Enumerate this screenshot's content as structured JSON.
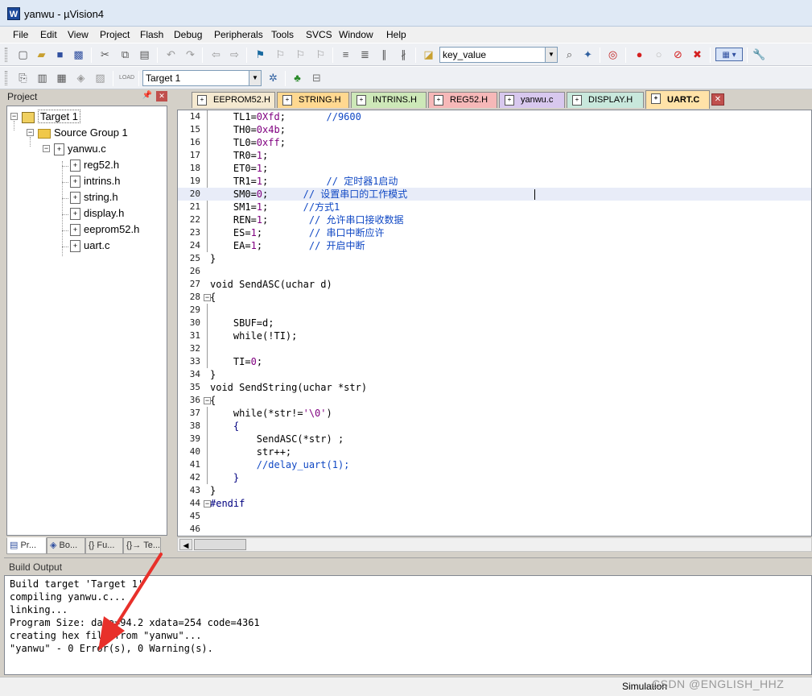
{
  "window": {
    "title": "yanwu  - µVision4",
    "icon": "uvision-app-icon"
  },
  "menu": [
    "File",
    "Edit",
    "View",
    "Project",
    "Flash",
    "Debug",
    "Peripherals",
    "Tools",
    "SVCS",
    "Window",
    "Help"
  ],
  "toolbar": {
    "find_combo_value": "key_value",
    "target_combo_value": "Target 1"
  },
  "project": {
    "title": "Project",
    "target": "Target 1",
    "group": "Source Group 1",
    "main_file": "yanwu.c",
    "files": [
      "reg52.h",
      "intrins.h",
      "string.h",
      "display.h",
      "eeprom52.h",
      "uart.c"
    ],
    "tabs": [
      "Pr...",
      "Bo...",
      "{} Fu...",
      "{}→ Te..."
    ]
  },
  "editor": {
    "tabs": [
      {
        "label": "EEPROM52.H",
        "color": "#f5e9d0"
      },
      {
        "label": "STRING.H",
        "color": "#ffd890"
      },
      {
        "label": "INTRINS.H",
        "color": "#cde8b8"
      },
      {
        "label": "REG52.H",
        "color": "#f6b8b8"
      },
      {
        "label": "yanwu.c",
        "color": "#d8c8ee"
      },
      {
        "label": "DISPLAY.H",
        "color": "#c8e8dc"
      },
      {
        "label": "UART.C",
        "color": "#ffe2a8"
      }
    ],
    "lines": [
      {
        "n": "14",
        "code": "    TL1=0Xfd;       //9600"
      },
      {
        "n": "15",
        "code": "    TH0=0x4b;"
      },
      {
        "n": "16",
        "code": "    TL0=0xff;"
      },
      {
        "n": "17",
        "code": "    TR0=1;"
      },
      {
        "n": "18",
        "code": "    ET0=1;"
      },
      {
        "n": "19",
        "code": "    TR1=1;          // 定时器1启动"
      },
      {
        "n": "20",
        "code": "    SM0=0;      // 设置串口的工作模式"
      },
      {
        "n": "21",
        "code": "    SM1=1;      //方式1"
      },
      {
        "n": "22",
        "code": "    REN=1;       // 允许串口接收数据"
      },
      {
        "n": "23",
        "code": "    ES=1;        // 串口中断应许"
      },
      {
        "n": "24",
        "code": "    EA=1;        // 开启中断"
      },
      {
        "n": "25",
        "code": "}"
      },
      {
        "n": "26",
        "code": ""
      },
      {
        "n": "27",
        "code": "void SendASC(uchar d)"
      },
      {
        "n": "28",
        "code": "{"
      },
      {
        "n": "29",
        "code": ""
      },
      {
        "n": "30",
        "code": "    SBUF=d;"
      },
      {
        "n": "31",
        "code": "    while(!TI);"
      },
      {
        "n": "32",
        "code": ""
      },
      {
        "n": "33",
        "code": "    TI=0;"
      },
      {
        "n": "34",
        "code": "}"
      },
      {
        "n": "35",
        "code": "void SendString(uchar *str)"
      },
      {
        "n": "36",
        "code": "{"
      },
      {
        "n": "37",
        "code": "    while(*str!='\\0')"
      },
      {
        "n": "38",
        "code": "    {"
      },
      {
        "n": "39",
        "code": "        SendASC(*str) ;"
      },
      {
        "n": "40",
        "code": "        str++;"
      },
      {
        "n": "41",
        "code": "        //delay_uart(1);"
      },
      {
        "n": "42",
        "code": "    }"
      },
      {
        "n": "43",
        "code": "}"
      },
      {
        "n": "44",
        "code": "#endif"
      },
      {
        "n": "45",
        "code": ""
      },
      {
        "n": "46",
        "code": ""
      }
    ]
  },
  "build_output": {
    "title": "Build Output",
    "lines": [
      "Build target 'Target 1'",
      "compiling yanwu.c...",
      "linking...",
      "Program Size: data=94.2 xdata=254 code=4361",
      "creating hex file from \"yanwu\"...",
      "\"yanwu\" - 0 Error(s), 0 Warning(s)."
    ]
  },
  "status": {
    "mode": "Simulation",
    "watermark": "CSDN @ENGLISH_HHZ"
  },
  "colors": {
    "annotation_arrow": "#e8302a",
    "current_line": "#e8ecf8",
    "comment": "#1048c4"
  }
}
